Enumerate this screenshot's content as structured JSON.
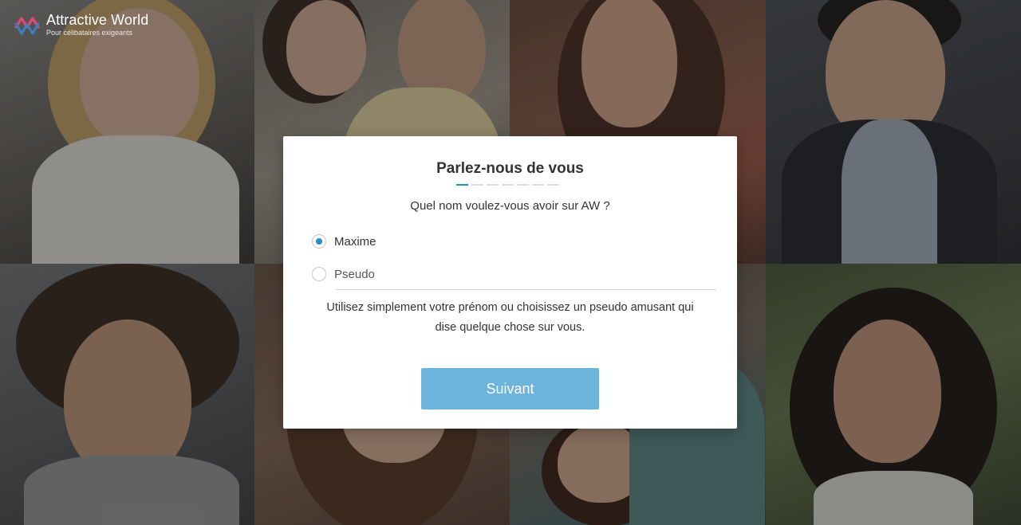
{
  "brand": {
    "name": "Attractive World",
    "tagline": "Pour célibataires exigeants",
    "colors": {
      "pink": "#e4477a",
      "blue": "#3b7fc4"
    }
  },
  "modal": {
    "title": "Parlez-nous de vous",
    "progress": {
      "total_steps": 7,
      "current_step": 1
    },
    "question": "Quel nom voulez-vous avoir sur AW ?",
    "options": [
      {
        "label": "Maxime",
        "checked": true
      },
      {
        "label": "Pseudo",
        "checked": false
      }
    ],
    "help_line1": "Utilisez simplement votre prénom ou choisissez un pseudo amusant qui",
    "help_line2": "dise quelque chose sur vous.",
    "next_button": "Suivant"
  },
  "colors": {
    "accent": "#2d8ac7",
    "button": "#6cb4dc",
    "text": "#333333"
  }
}
